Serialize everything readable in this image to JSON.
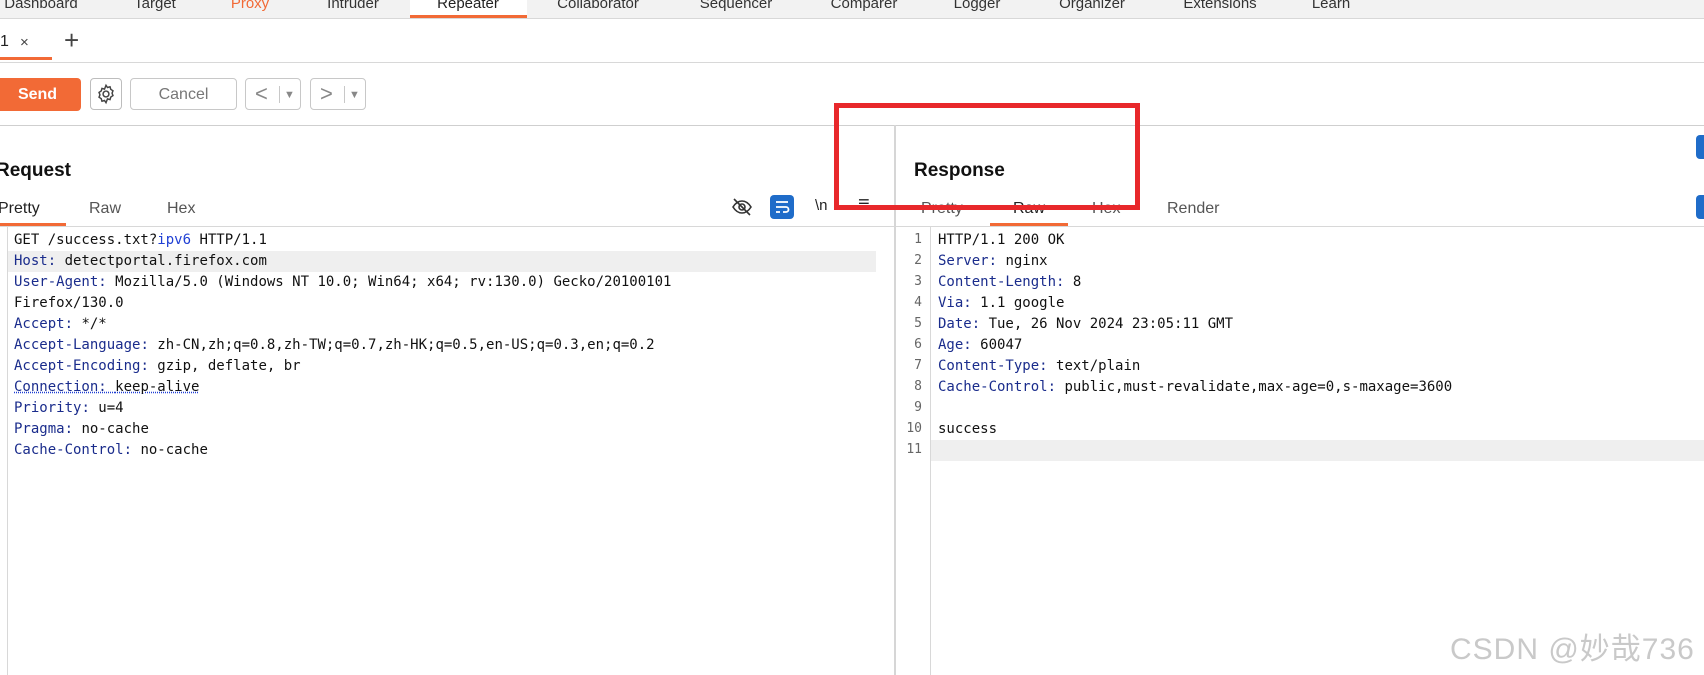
{
  "topnav": {
    "items": [
      "Dashboard",
      "Target",
      "Proxy",
      "Intruder",
      "Repeater",
      "Collaborator",
      "Sequencer",
      "Comparer",
      "Logger",
      "Organizer",
      "Extensions",
      "Learn"
    ]
  },
  "tabs": {
    "tab1_label": "1",
    "close_glyph": "×",
    "add_glyph": "+"
  },
  "toolbar": {
    "send_label": "Send",
    "cancel_label": "Cancel",
    "back_glyph": "<",
    "forward_glyph": ">",
    "dropdown_glyph": "▼"
  },
  "request": {
    "title": "Request",
    "tabs": [
      "Pretty",
      "Raw",
      "Hex"
    ],
    "newline_label": "\\n",
    "menu_glyph": "≡",
    "lines": [
      {
        "name": "",
        "value": "GET /success.txt?ipv6 HTTP/1.1"
      },
      {
        "name": "Host",
        "value": "detectportal.firefox.com"
      },
      {
        "name": "User-Agent",
        "value": "Mozilla/5.0 (Windows NT 10.0; Win64; x64; rv:130.0) Gecko/20100101"
      },
      {
        "name": "",
        "value": "Firefox/130.0"
      },
      {
        "name": "Accept",
        "value": "*/*"
      },
      {
        "name": "Accept-Language",
        "value": "zh-CN,zh;q=0.8,zh-TW;q=0.7,zh-HK;q=0.5,en-US;q=0.3,en;q=0.2"
      },
      {
        "name": "Accept-Encoding",
        "value": "gzip, deflate, br"
      },
      {
        "name": "Connection",
        "value": "keep-alive"
      },
      {
        "name": "Priority",
        "value": "u=4"
      },
      {
        "name": "Pragma",
        "value": "no-cache"
      },
      {
        "name": "Cache-Control",
        "value": "no-cache"
      }
    ]
  },
  "response": {
    "title": "Response",
    "tabs": [
      "Pretty",
      "Raw",
      "Hex",
      "Render"
    ],
    "line_numbers": [
      "1",
      "2",
      "3",
      "4",
      "5",
      "6",
      "7",
      "8",
      "9",
      "10",
      "11"
    ],
    "lines": [
      {
        "name": "",
        "value": "HTTP/1.1 200 OK"
      },
      {
        "name": "Server",
        "value": "nginx"
      },
      {
        "name": "Content-Length",
        "value": "8"
      },
      {
        "name": "Via",
        "value": "1.1 google"
      },
      {
        "name": "Date",
        "value": "Tue, 26 Nov 2024 23:05:11 GMT"
      },
      {
        "name": "Age",
        "value": "60047"
      },
      {
        "name": "Content-Type",
        "value": "text/plain"
      },
      {
        "name": "Cache-Control",
        "value": "public,must-revalidate,max-age=0,s-maxage=3600"
      },
      {
        "name": "",
        "value": ""
      },
      {
        "name": "",
        "value": "success"
      },
      {
        "name": "",
        "value": ""
      }
    ]
  },
  "watermark": "CSDN @妙哉736",
  "colors": {
    "accent": "#f26a36",
    "header_name": "#1a2c8c",
    "annotation_box": "#e8282b"
  }
}
